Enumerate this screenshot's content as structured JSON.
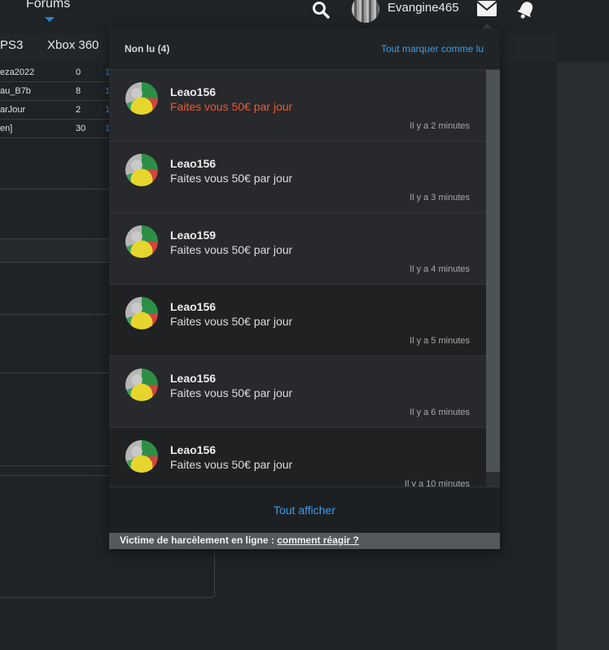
{
  "header": {
    "forums_label": "Forums",
    "username": "Evangine465"
  },
  "subnav": {
    "platforms": [
      "PS3",
      "Xbox 360"
    ]
  },
  "background_table": [
    {
      "name": "eza2022",
      "count": "0",
      "extra": "1"
    },
    {
      "name": "au_B7b",
      "count": "8",
      "extra": "1"
    },
    {
      "name": "arJour",
      "count": "2",
      "extra": "1"
    },
    {
      "name": "en]",
      "count": "30",
      "extra": "1"
    }
  ],
  "notifications": {
    "unread_label": "Non lu (4)",
    "mark_all_label": "Tout marquer comme lu",
    "items": [
      {
        "author": "Leao156",
        "message": "Faites vous 50€ par jour",
        "time": "Il y a 2 minutes"
      },
      {
        "author": "Leao156",
        "message": "Faites vous 50€ par jour",
        "time": "Il y a 3 minutes"
      },
      {
        "author": "Leao159",
        "message": "Faites vous 50€ par jour",
        "time": "Il y a 4 minutes"
      },
      {
        "author": "Leao156",
        "message": "Faites vous 50€ par jour",
        "time": "Il y a 5 minutes"
      },
      {
        "author": "Leao156",
        "message": "Faites vous 50€ par jour",
        "time": "Il y a 6 minutes"
      },
      {
        "author": "Leao156",
        "message": "Faites vous 50€ par jour",
        "time": "Il y a 10 minutes"
      }
    ],
    "show_all_label": "Tout afficher"
  },
  "harassment": {
    "text": "Victime de harcèlement en ligne : ",
    "link": "comment réagir ?"
  },
  "colors": {
    "accent": "#3d9be9",
    "highlight": "#f0572d"
  },
  "icons": [
    "search-icon",
    "mail-icon",
    "bell-icon",
    "chevron-down-icon"
  ]
}
